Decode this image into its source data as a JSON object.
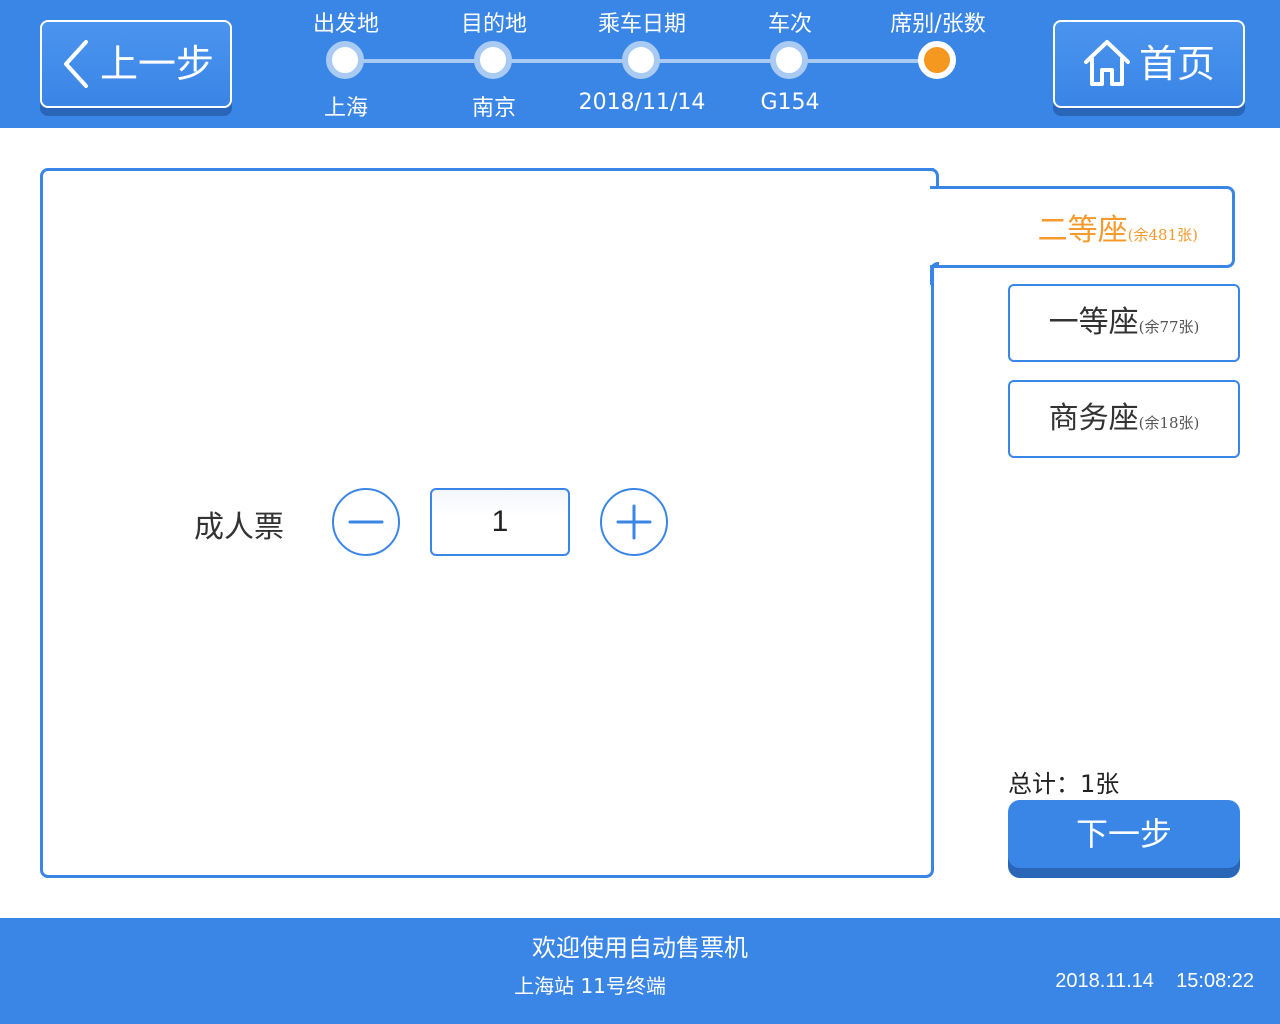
{
  "header": {
    "back_label": "上一步",
    "home_label": "首页",
    "steps": [
      {
        "title": "出发地",
        "value": "上海"
      },
      {
        "title": "目的地",
        "value": "南京"
      },
      {
        "title": "乘车日期",
        "value": "2018/11/14"
      },
      {
        "title": "车次",
        "value": "G154"
      },
      {
        "title": "席别/张数",
        "value": ""
      }
    ],
    "current_step": 5
  },
  "seats": [
    {
      "name": "二等座",
      "remaining": "(余481张)",
      "selected": true
    },
    {
      "name": "一等座",
      "remaining": "(余77张)",
      "selected": false
    },
    {
      "name": "商务座",
      "remaining": "(余18张)",
      "selected": false
    }
  ],
  "ticket": {
    "type_label": "成人票",
    "quantity": "1"
  },
  "summary": {
    "total_text": "总计：1张",
    "next_label": "下一步"
  },
  "footer": {
    "welcome": "欢迎使用自动售票机",
    "station": "上海站 11号终端",
    "datetime": "2018.11.14    15:08:22"
  },
  "colors": {
    "primary": "#3a86e6",
    "accent": "#f5981f",
    "background": "#ffffff"
  }
}
